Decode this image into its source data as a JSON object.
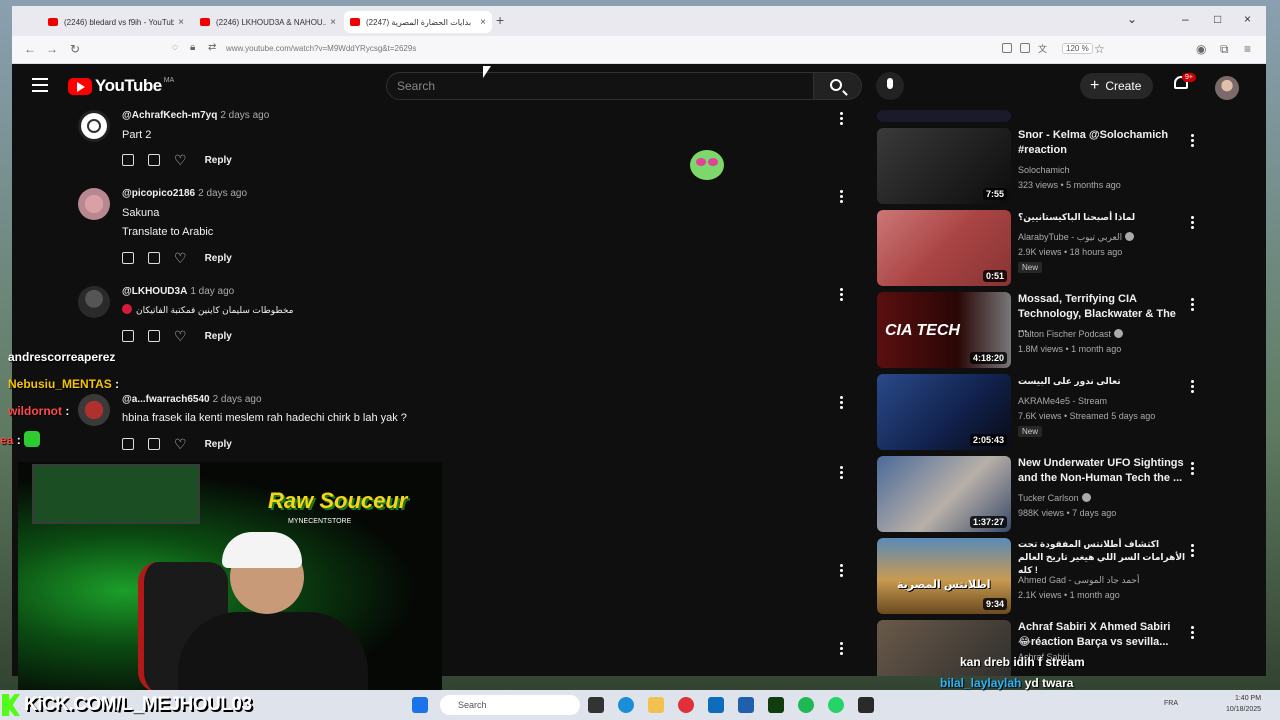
{
  "browser": {
    "tabs": [
      {
        "label": "(2246) bledard vs f9ih - YouTube",
        "active": false
      },
      {
        "label": "(2246) LKHOUD3A & NAHOU...",
        "active": false
      },
      {
        "label": "(2247) بدايات الحضارة المصرية",
        "active": true
      }
    ],
    "new_tab": "+",
    "url": "www.youtube.com/watch?v=M9WddYRycsg&t=2629s",
    "zoom": "120 %"
  },
  "youtube": {
    "logo_word": "YouTube",
    "country_code": "MA",
    "search_placeholder": "Search",
    "create_label": "Create",
    "notification_count": "9+"
  },
  "comments": [
    {
      "handle": "@AchrafKech-m7yq",
      "time": "2 days ago",
      "lines": [
        "Part 2"
      ],
      "reply": "Reply"
    },
    {
      "handle": "@picopico2186",
      "time": "2 days ago",
      "lines": [
        "Sakuna",
        "Translate to Arabic"
      ],
      "reply": "Reply"
    },
    {
      "handle": "@LKHOUD3A",
      "time": "1 day ago",
      "lines": [
        "مخطوطات سليمان كاينين فمكتبة الفاتيكان"
      ],
      "reply": "Reply"
    },
    {
      "handle": "@a...fwarrach6540",
      "time": "2 days ago",
      "lines": [
        "hbina frasek ila kenti meslem rah hadechi chirk b lah yak ?"
      ],
      "reply": "Reply"
    }
  ],
  "videos": [
    {
      "title": "Snor - Kelma @Solochamich #reaction",
      "channel": "Solochamich",
      "meta": "323 views • 5 months ago",
      "duration": "7:55",
      "verified": false,
      "badge": ""
    },
    {
      "title": "لماذا أصبحنا الباكيستانيين؟",
      "channel": "AlarabyTube - العربي تيوب",
      "meta": "2.9K views • 18 hours ago",
      "duration": "0:51",
      "verified": true,
      "badge": "New"
    },
    {
      "title": "Mossad, Terrifying CIA Technology, Blackwater & The ...",
      "channel": "Dalton Fischer Podcast",
      "meta": "1.8M views • 1 month ago",
      "duration": "4:18:20",
      "verified": true,
      "badge": "",
      "thumb_text": "CIA TECH"
    },
    {
      "title": "تعالى ندور على البيست",
      "channel": "AKRAMe4e5 - Stream",
      "meta": "7.6K views • Streamed 5 days ago",
      "duration": "2:05:43",
      "verified": false,
      "badge": "New"
    },
    {
      "title": "New Underwater UFO Sightings and the Non-Human Tech the ...",
      "channel": "Tucker Carlson",
      "meta": "988K views • 7 days ago",
      "duration": "1:37:27",
      "verified": true,
      "badge": ""
    },
    {
      "title": "اكتشاف أطلانتس المفقودة تحت الأهرامات السر اللي هيغير تاريخ العالم كله !",
      "channel": "Ahmed Gad - أحمد جاد الموسى",
      "meta": "2.1K views • 1 month ago",
      "duration": "9:34",
      "verified": false,
      "badge": "",
      "thumb_text": "اطلانتس المصرية"
    },
    {
      "title": "Achraf Sabiri X Ahmed Sabiri 😂réaction Barça vs sevilla...",
      "channel": "Achraf Sabiri",
      "meta": "",
      "duration": "",
      "verified": false,
      "badge": ""
    }
  ],
  "stream": {
    "chat": [
      {
        "user": "andrescorreaperez",
        "text": ""
      },
      {
        "user": "Nebusiu_MENTAS",
        "text": ":"
      },
      {
        "user": "wildornot",
        "text": ":"
      },
      {
        "user": "ea",
        "text": ":"
      }
    ],
    "bottom_chat": [
      {
        "user": "",
        "text": "kan dreb idih f stream"
      },
      {
        "user": "bilal_laylaylah",
        "text": "yd twara"
      }
    ],
    "kick_url": "KiCK.COM/L_MEJHOUL03",
    "overlay_logo": "Raw Souceur",
    "overlay_sub": "MYNECENTSTORE"
  },
  "taskbar": {
    "search_placeholder": "Search",
    "lang": "FRA",
    "time": "1:40 PM",
    "date": "10/18/2025"
  },
  "colors": {
    "yt_bg": "#0f0f0f",
    "yt_red": "#ff0000",
    "kick_green": "#53fc18"
  }
}
